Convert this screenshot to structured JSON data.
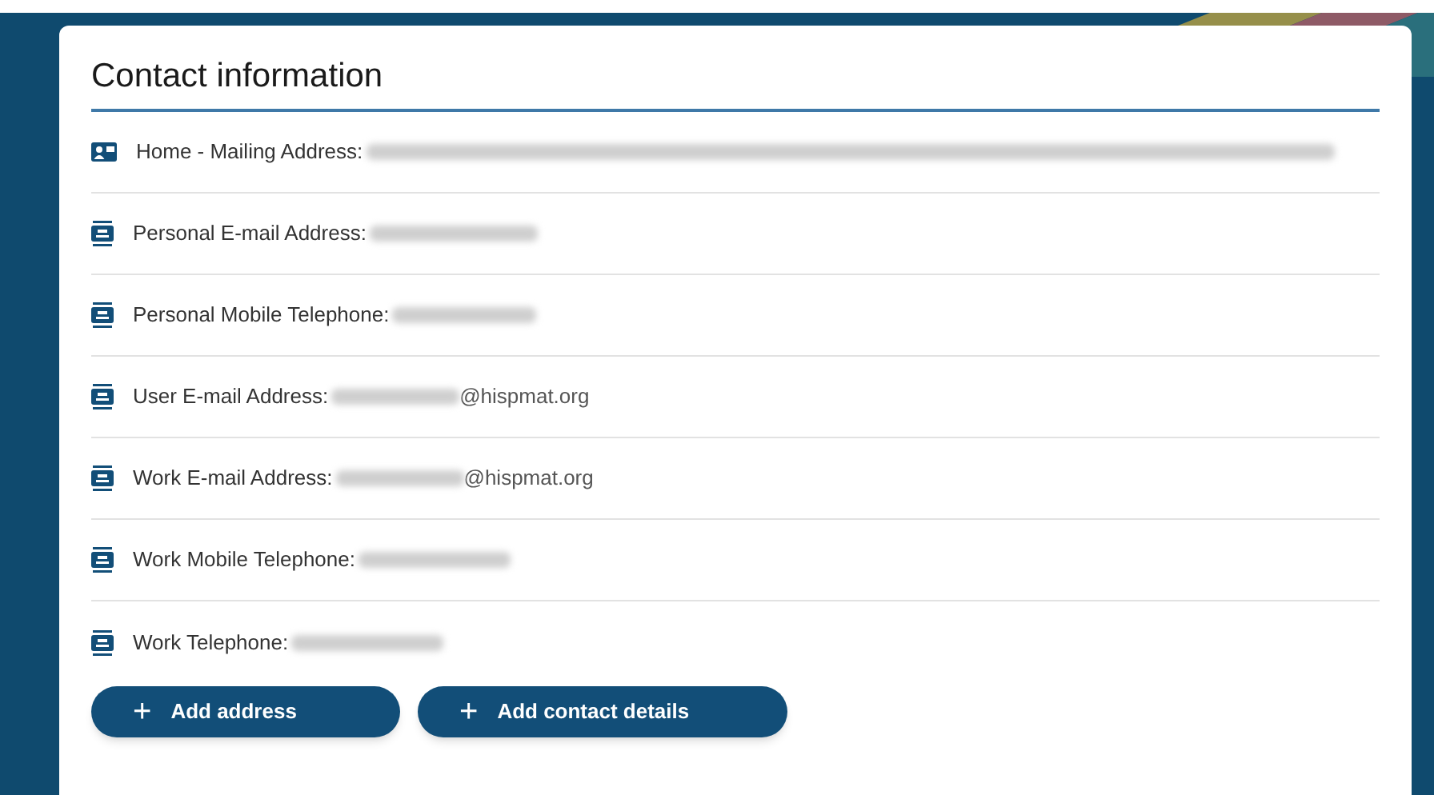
{
  "title": "Contact information",
  "items": [
    {
      "kind": "address",
      "label": "Home - Mailing Address:"
    },
    {
      "kind": "contact",
      "label": "Personal E-mail Address:"
    },
    {
      "kind": "contact",
      "label": "Personal Mobile Telephone:"
    },
    {
      "kind": "contact",
      "label": "User E-mail Address:",
      "suffix": "@hispmat.org"
    },
    {
      "kind": "contact",
      "label": "Work E-mail Address:",
      "suffix": "@hispmat.org"
    },
    {
      "kind": "contact",
      "label": "Work Mobile Telephone:"
    },
    {
      "kind": "contact",
      "label": "Work Telephone:"
    }
  ],
  "buttons": [
    {
      "icon": "+",
      "label": "Add address"
    },
    {
      "icon": "+",
      "label": "Add contact details"
    }
  ]
}
